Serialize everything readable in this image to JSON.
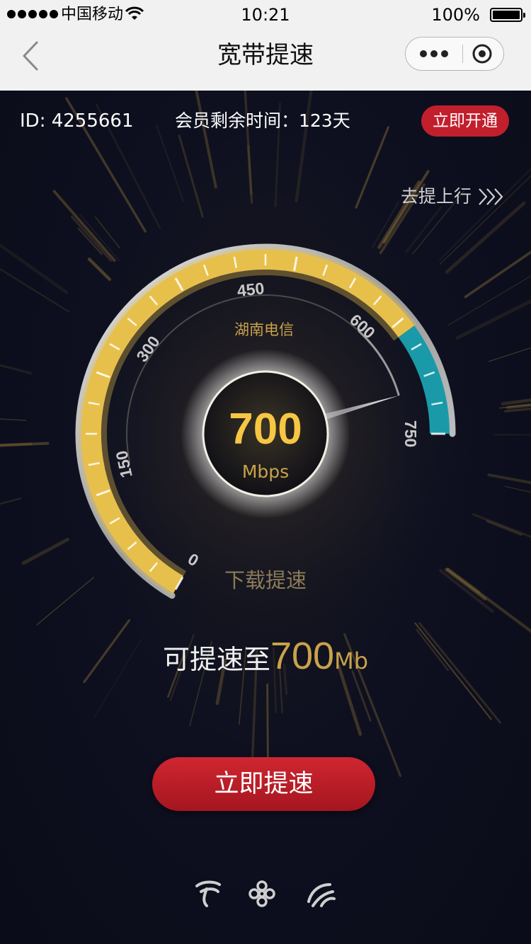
{
  "status_bar": {
    "carrier": "中国移动",
    "time": "10:21",
    "battery": "100%"
  },
  "nav": {
    "title": "宽带提速"
  },
  "account": {
    "id_text": "ID: 4255661",
    "member_text": "会员剩余时间：123天",
    "open_button": "立即开通"
  },
  "upload_link": "去提上行",
  "gauge": {
    "isp": "湖南电信",
    "speed": "700",
    "unit": "Mbps",
    "min": 0,
    "max": 750,
    "current": 700,
    "tick_labels": [
      "0",
      "150",
      "300",
      "450",
      "600",
      "750"
    ],
    "mode": "下载提速",
    "colors": {
      "gold": "#e7c04c",
      "teal": "#1a9aa8",
      "rim": "#c9c9c9"
    }
  },
  "boost": {
    "prefix": "可提速至",
    "value": "700",
    "unit": "Mb"
  },
  "speedup_button": "立即提速",
  "footer_logos": [
    "china-telecom-logo-icon",
    "china-unicom-logo-icon",
    "china-mobile-logo-icon"
  ]
}
